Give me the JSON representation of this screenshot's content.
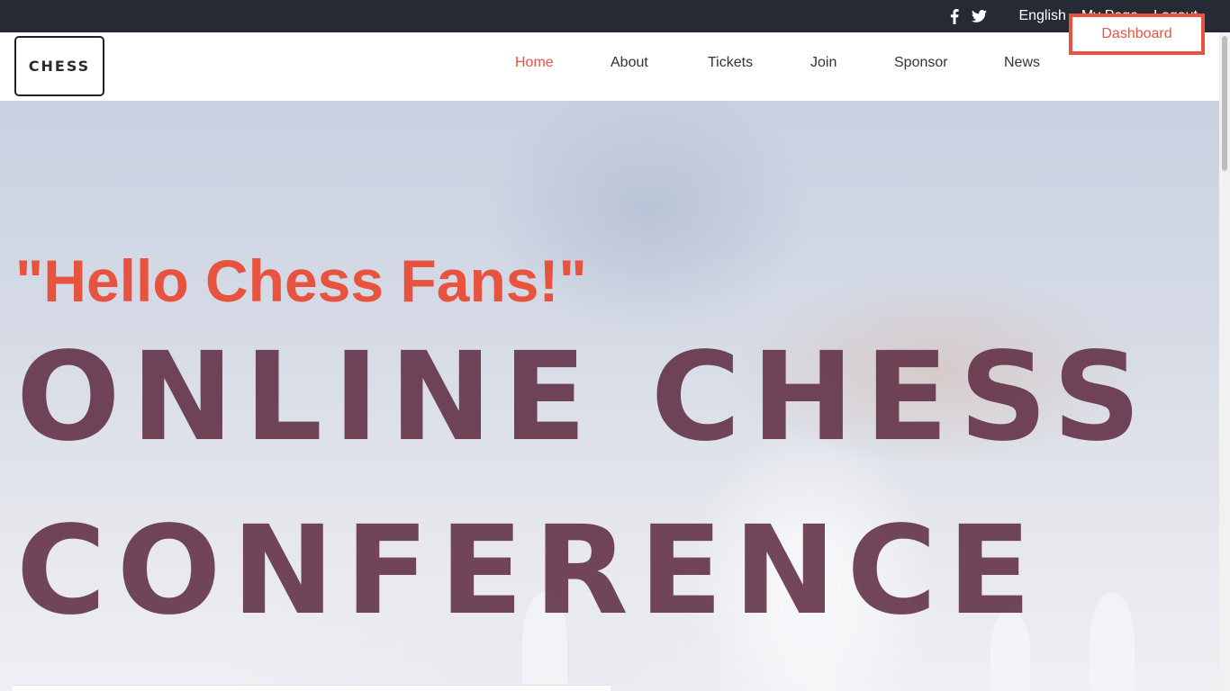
{
  "topbar": {
    "social": [
      {
        "icon": "facebook-icon"
      },
      {
        "icon": "twitter-icon"
      }
    ],
    "links": [
      "English",
      "My Page",
      "Logout"
    ]
  },
  "header": {
    "logo_text": "CHESS",
    "nav": [
      "Home",
      "About",
      "Tickets",
      "Join",
      "Sponsor",
      "News"
    ],
    "active_nav": "Home",
    "dashboard_label": "Dashboard"
  },
  "hero": {
    "greeting": "\"Hello Chess Fans!\"",
    "title_line1": "ONLINE CHESS",
    "title_line2": "CONFERENCE"
  },
  "colors": {
    "accent": "#e8533f",
    "topbar_bg": "#252a35",
    "title": "#5e2a40"
  }
}
